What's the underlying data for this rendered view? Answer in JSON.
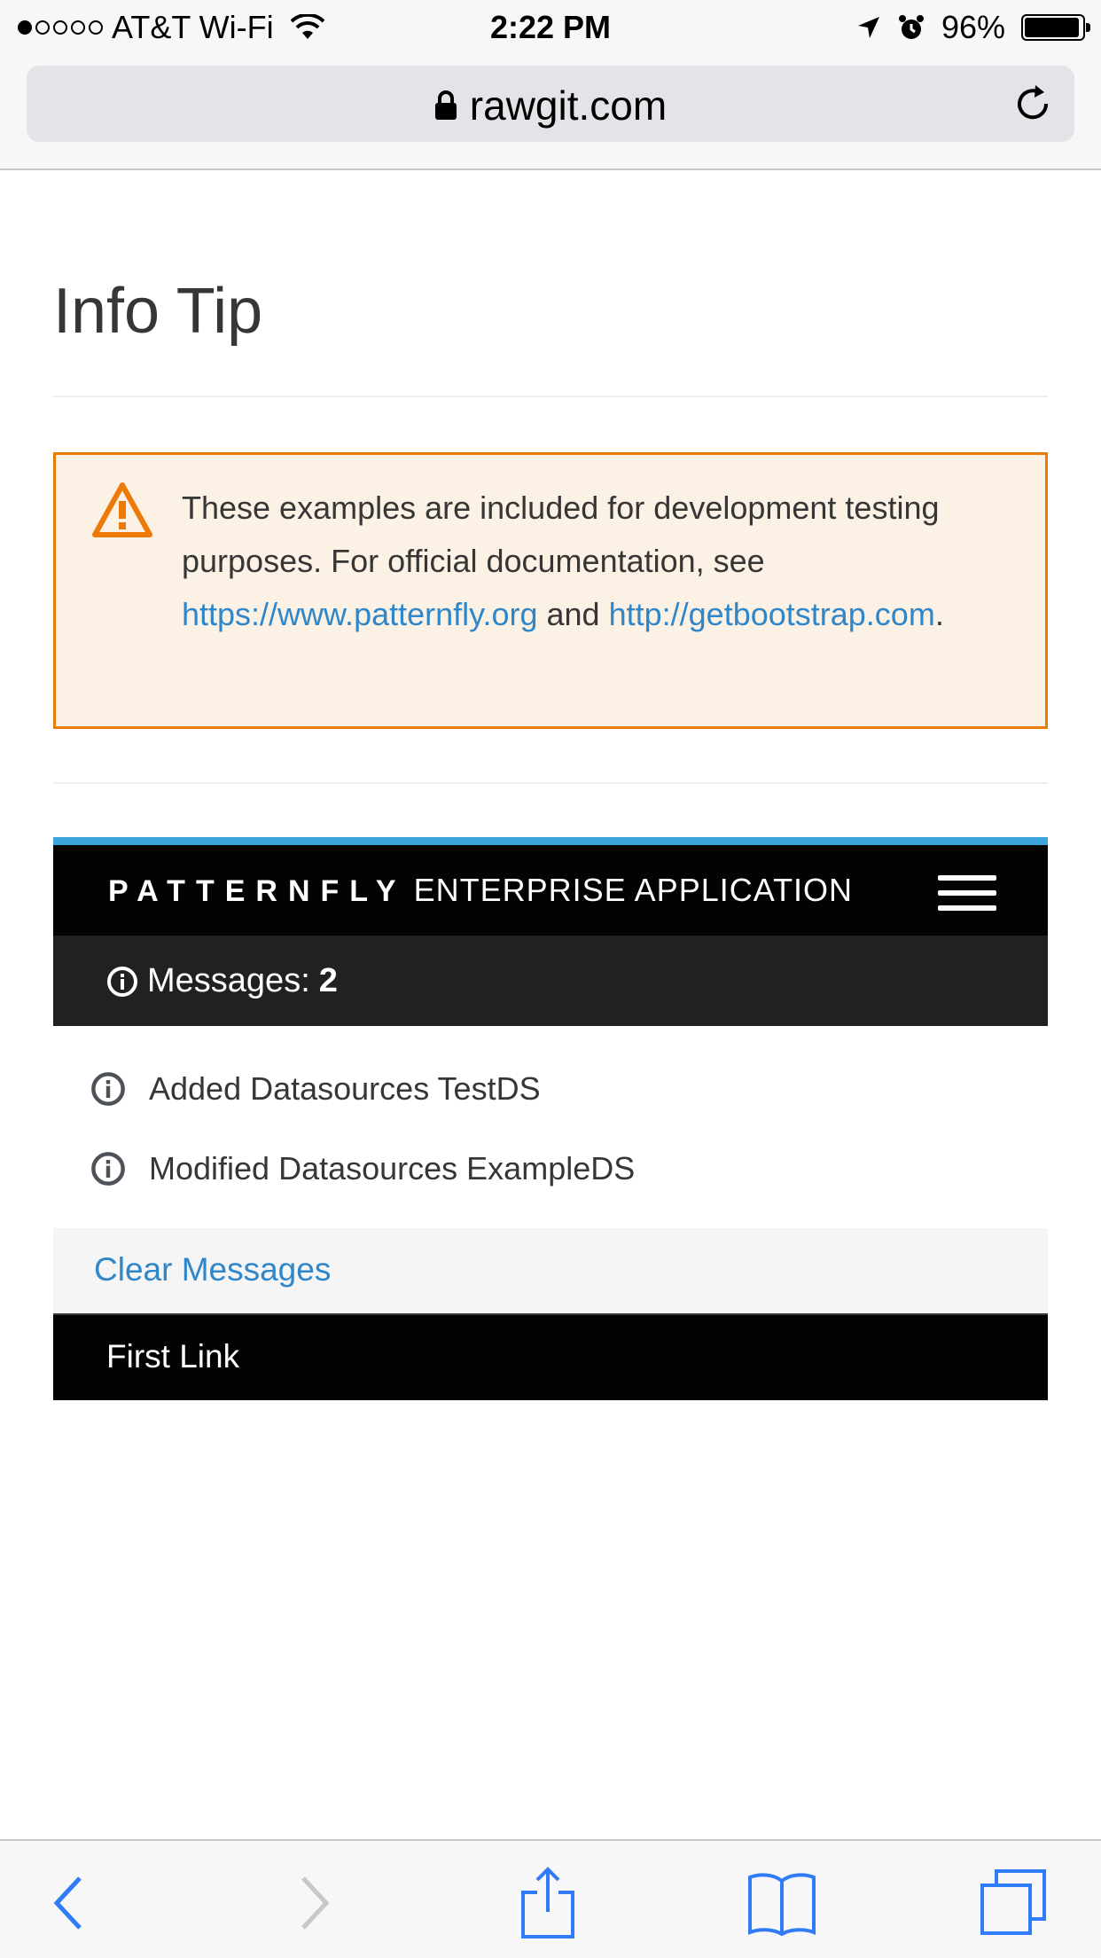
{
  "status_bar": {
    "carrier": "AT&T Wi-Fi",
    "time": "2:22 PM",
    "battery_pct": "96%",
    "battery_level": 0.96,
    "signal_bars": 1,
    "signal_total": 5
  },
  "browser": {
    "url": "rawgit.com",
    "icons": [
      "lock-icon",
      "reload-icon",
      "back-icon",
      "forward-icon",
      "share-icon",
      "bookmarks-icon",
      "tabs-icon"
    ]
  },
  "page": {
    "title": "Info Tip"
  },
  "alert": {
    "icon": "warning-triangle-icon",
    "accent_color": "#ec7a08",
    "text_before": "These examples are included for development testing purposes. For official documentation, see ",
    "link1": "https://www.patternfly.org",
    "text_middle": " and ",
    "link2": "http://getbootstrap.com",
    "text_after": "."
  },
  "navbar": {
    "brand_name": "PATTERNFLY",
    "brand_app": "ENTERPRISE APPLICATION",
    "accent_color": "#39a5dc",
    "messages_label": "Messages:",
    "messages_count": "2",
    "messages": [
      {
        "text": "Added Datasources TestDS"
      },
      {
        "text": "Modified Datasources ExampleDS"
      }
    ],
    "clear_label": "Clear Messages",
    "first_link": "First Link"
  }
}
